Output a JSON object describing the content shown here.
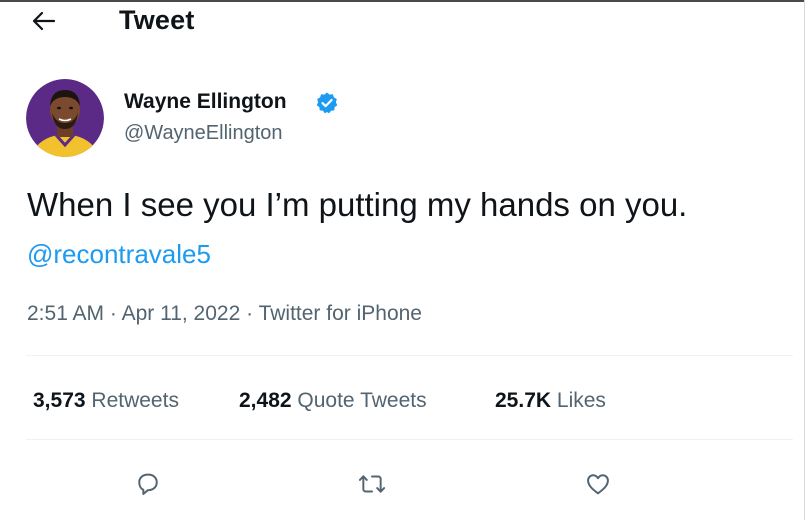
{
  "header": {
    "title": "Tweet",
    "back_icon": "arrow-left-icon"
  },
  "author": {
    "name": "Wayne Ellington",
    "handle": "@WayneEllington",
    "verified_icon": "verified-badge-icon"
  },
  "tweet": {
    "text": "When I see you I’m putting my hands on you.",
    "mention": "@recontravale5"
  },
  "meta": {
    "time": "2:51 AM",
    "separator": " · ",
    "date": "Apr 11, 2022",
    "source": "Twitter for iPhone"
  },
  "stats": [
    {
      "value": "3,573",
      "label": "Retweets"
    },
    {
      "value": "2,482",
      "label": "Quote Tweets"
    },
    {
      "value": "25.7K",
      "label": "Likes"
    }
  ],
  "actions": [
    {
      "icon": "reply-icon"
    },
    {
      "icon": "retweet-icon"
    },
    {
      "icon": "like-icon"
    }
  ],
  "colors": {
    "text": "#0f1419",
    "secondary": "#536471",
    "link": "#1d9bf0",
    "divider": "#eff3f4",
    "avatar_bg": "#5b2a86",
    "jersey": "#f2c12e"
  }
}
